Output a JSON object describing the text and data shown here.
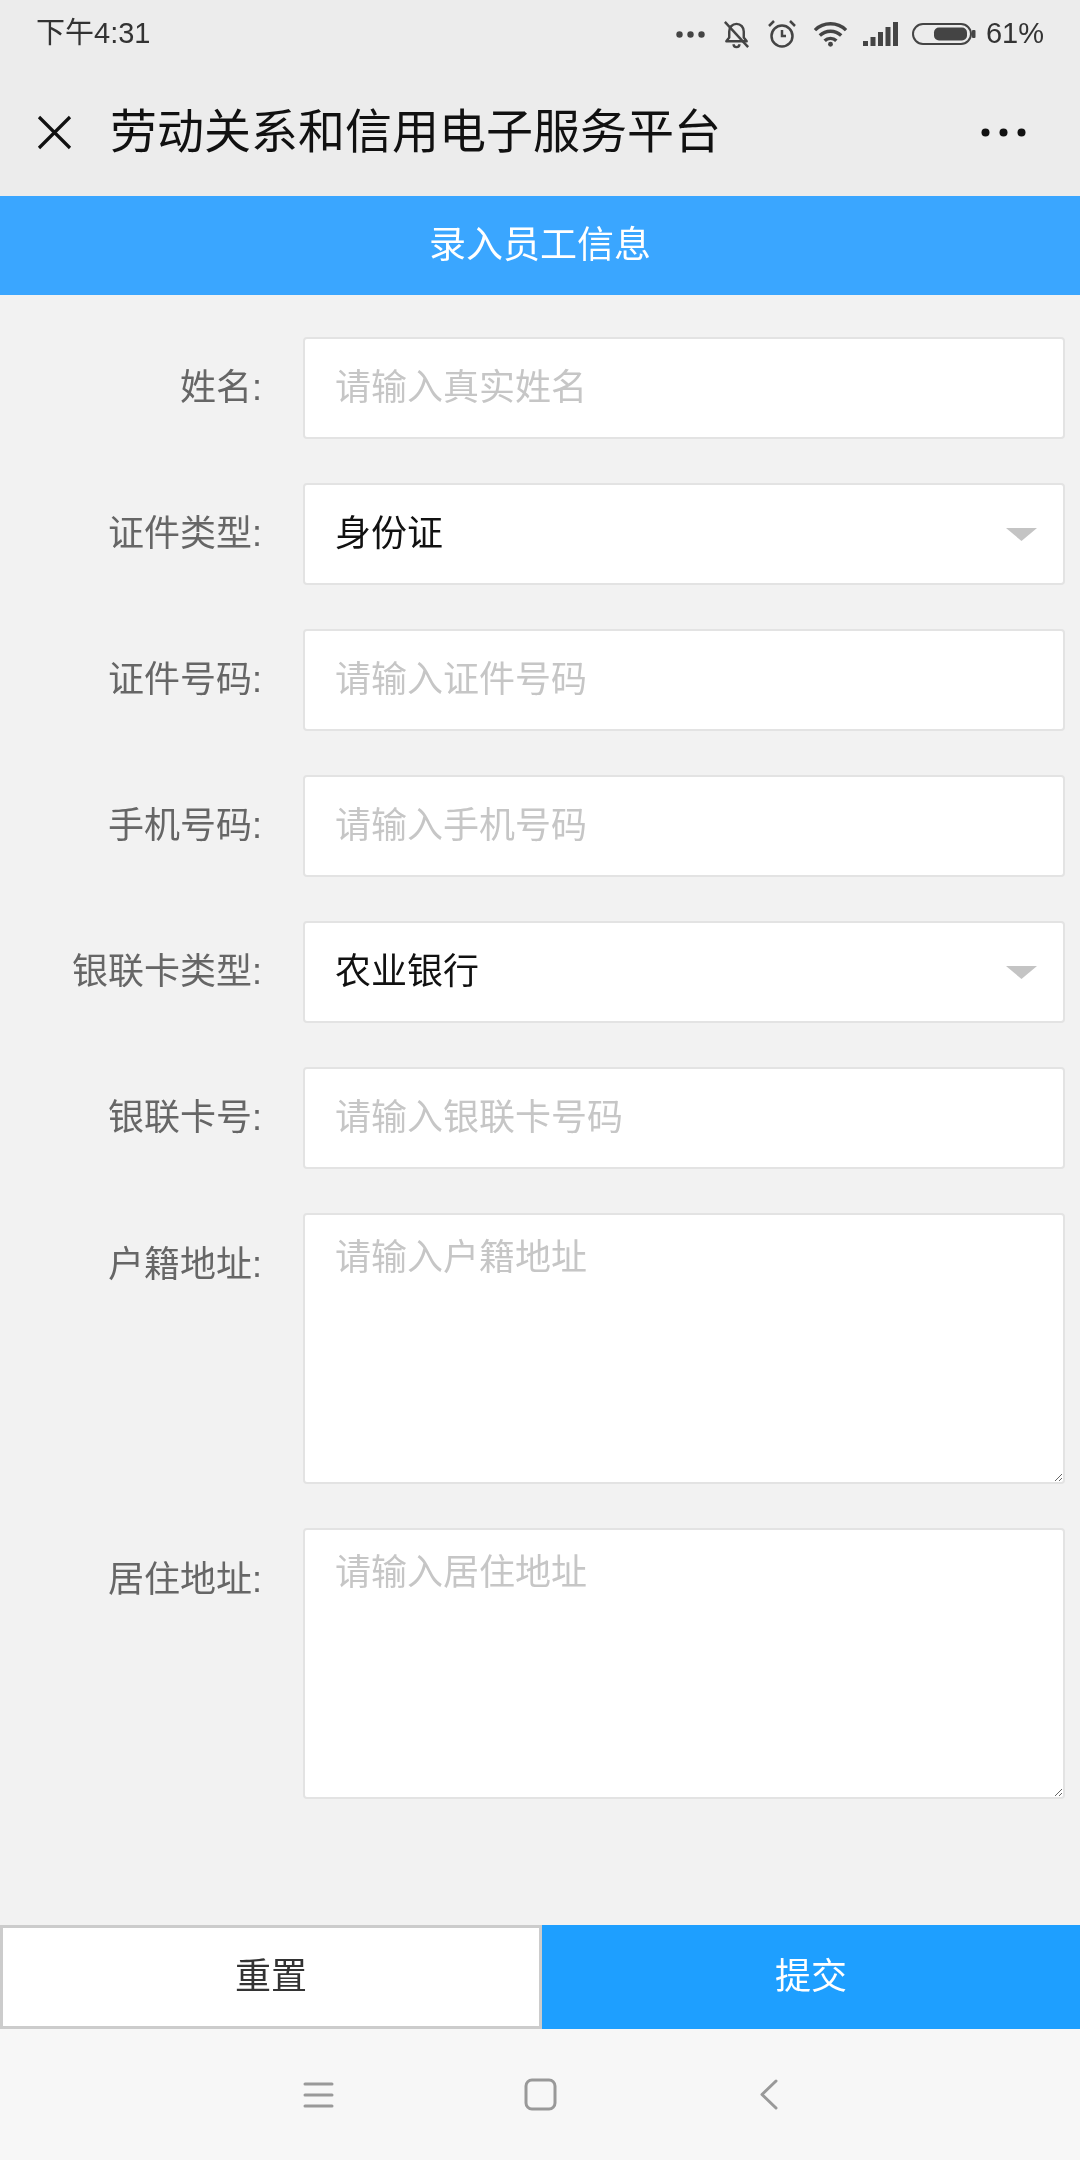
{
  "status_bar": {
    "time": "下午4:31",
    "battery": "61%"
  },
  "header": {
    "title": "劳动关系和信用电子服务平台"
  },
  "banner": {
    "title": "录入员工信息"
  },
  "form": {
    "fields": [
      {
        "kind": "text",
        "label": "姓名:",
        "placeholder": "请输入真实姓名"
      },
      {
        "kind": "select",
        "label": "证件类型:",
        "value": "身份证"
      },
      {
        "kind": "text",
        "label": "证件号码:",
        "placeholder": "请输入证件号码"
      },
      {
        "kind": "text",
        "label": "手机号码:",
        "placeholder": "请输入手机号码"
      },
      {
        "kind": "select",
        "label": "银联卡类型:",
        "value": "农业银行"
      },
      {
        "kind": "text",
        "label": "银联卡号:",
        "placeholder": "请输入银联卡号码"
      },
      {
        "kind": "textarea",
        "label": "户籍地址:",
        "placeholder": "请输入户籍地址"
      },
      {
        "kind": "textarea",
        "label": "居住地址:",
        "placeholder": "请输入居住地址"
      }
    ]
  },
  "buttons": [
    {
      "kind": "reset",
      "label": "重置"
    },
    {
      "kind": "submit",
      "label": "提交"
    }
  ]
}
